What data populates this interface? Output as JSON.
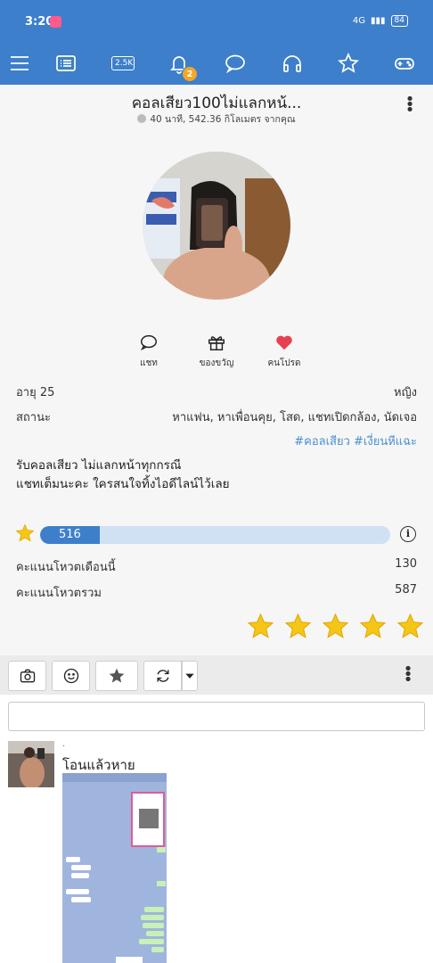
{
  "status_bar": {
    "time": "3:20",
    "battery": "84",
    "network": "4G"
  },
  "nav": {
    "menu_icon": "hamburger-icon",
    "list_icon": "list-icon",
    "count_label": "2.5K",
    "bell_badge": "2",
    "icons": [
      "hamburger-icon",
      "list-icon",
      "count-icon",
      "bell-icon",
      "chat-bubble-icon",
      "headphones-icon",
      "star-outline-icon",
      "gamepad-icon"
    ]
  },
  "profile": {
    "title": "คอลเสียว100ไม่แลกหน้...",
    "subtitle": "40 นาที, 542.36 กิโลเมตร จากคุณ",
    "actions": [
      {
        "label": "แชท",
        "icon": "chat-icon"
      },
      {
        "label": "ของขวัญ",
        "icon": "gift-icon"
      },
      {
        "label": "คนโปรด",
        "icon": "heart-icon"
      }
    ],
    "age_label": "อายุ 25",
    "gender": "หญิง",
    "status_label": "สถานะ",
    "status_value": "หาแฟน, หาเพื่อนคุย, โสด, แชทเปิดกล้อง, นัดเจอ",
    "tags": "#คอลเสียว #เงี่ยนหีแฉะ",
    "bio_line1": "รับคอลเสียว ไม่แลกหน้าทุกกรณี",
    "bio_line2": "แชทเต็มนะคะ ใครสนใจทิ้งไอดีไลน์ไว้เลย"
  },
  "votes": {
    "score": "516",
    "fill_fraction": 0.17,
    "month_label": "คะแนนโหวตเดือนนี้",
    "month_value": "130",
    "total_label": "คะแนนโหวตรวม",
    "total_value": "587",
    "stars": 5
  },
  "colors": {
    "brand": "#3d7fcb",
    "accent_heart": "#e8404f",
    "star": "#f5c518",
    "tag": "#4a8fd1"
  },
  "post": {
    "dot": ".",
    "text": "โอนแล้วหาย"
  }
}
